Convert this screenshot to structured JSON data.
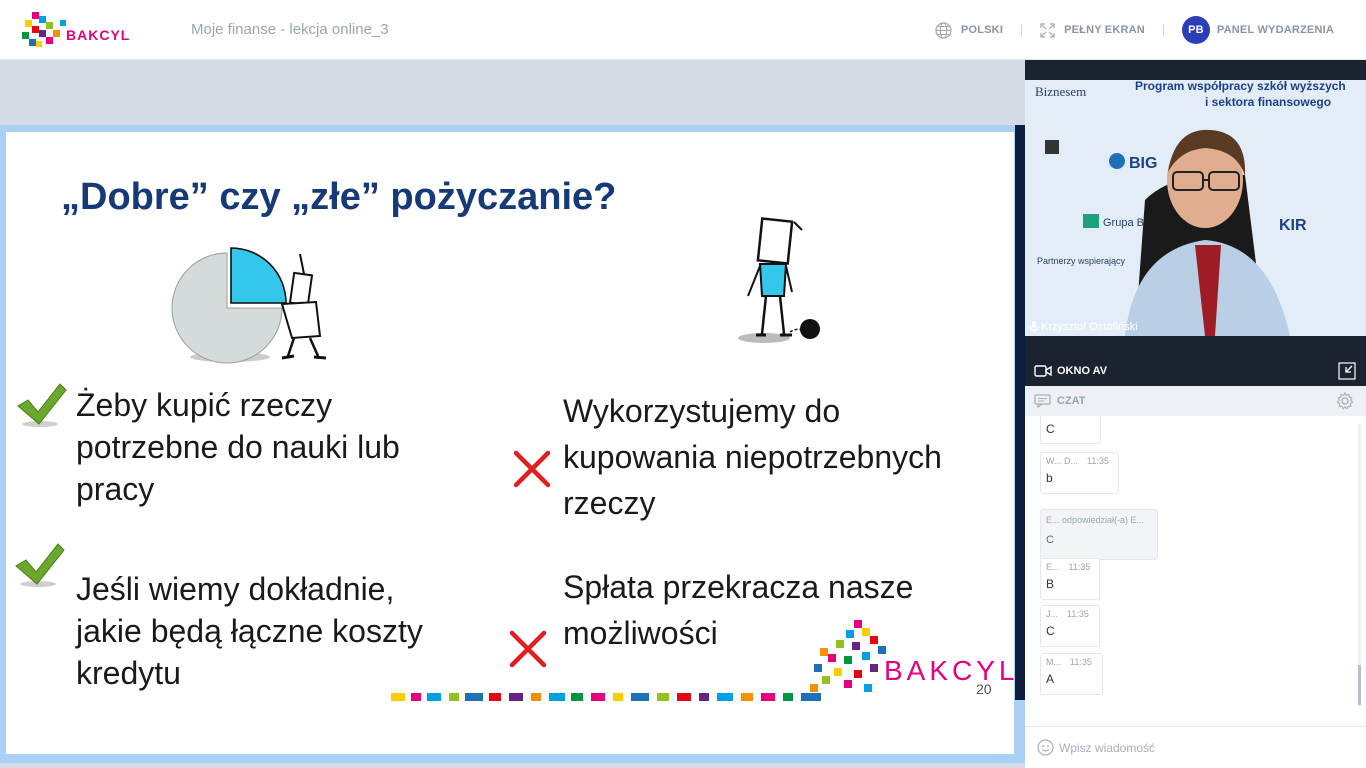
{
  "app": {
    "event_title": "Moje finanse - lekcja online_3",
    "logo_text": "BAKCYL",
    "language_label": "POLSKI",
    "fullscreen_label": "PEŁNY EKRAN",
    "user_initials": "PB",
    "panel_label": "PANEL WYDARZENIA"
  },
  "slide": {
    "title": "„Dobre” czy „złe” pożyczanie?",
    "good_items": [
      {
        "lines": [
          "Żeby kupić rzeczy",
          "potrzebne do nauki lub",
          "pracy"
        ]
      },
      {
        "lines": [
          "Jeśli wiemy dokładnie,",
          "jakie będą łączne koszty",
          "kredytu"
        ]
      }
    ],
    "bad_items": [
      {
        "lines": [
          "Wykorzystujemy do",
          "kupowania niepotrzebnych",
          "rzeczy"
        ]
      },
      {
        "lines": [
          "Spłata przekracza nasze",
          "możliwości"
        ]
      }
    ],
    "page_number": "20",
    "logo_text": "BAKCYL"
  },
  "video": {
    "speaker_name": "Krzysztof Ostafiński",
    "backdrop_text": [
      "Program współpracy szkół wyższych",
      "i sektora finansowego",
      "Biznesem",
      "Partnerzy wspierający",
      "BIG",
      "Grupa BPS",
      "KIR"
    ]
  },
  "av": {
    "label": "OKNO AV"
  },
  "chat": {
    "label": "CZAT",
    "messages": [
      {
        "author": "",
        "time": "",
        "text": "C"
      },
      {
        "author": "W... D...",
        "time": "11:35",
        "text": "b"
      },
      {
        "author": "E... odpowiedział(-a) E...",
        "time": "",
        "text": "C"
      },
      {
        "author": "E...",
        "time": "11:35",
        "text": "B"
      },
      {
        "author": "J...",
        "time": "11:35",
        "text": "C"
      },
      {
        "author": "M...",
        "time": "11:35",
        "text": "A"
      }
    ],
    "placeholder": "Wpisz wiadomość"
  },
  "colors": {
    "accent": "#2b3eb8",
    "slide_title": "#163a78",
    "check": "#6aa82c",
    "cross": "#e02020",
    "frame": "#a9d0f5"
  }
}
